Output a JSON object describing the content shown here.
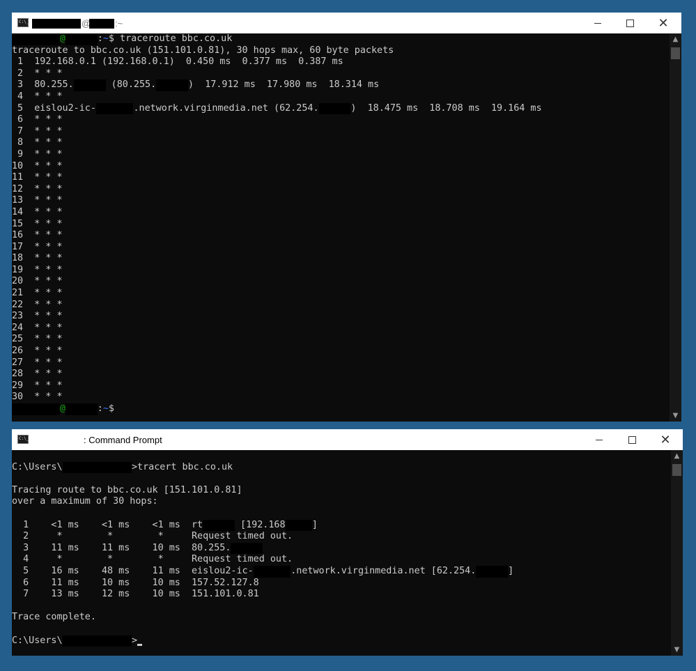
{
  "window1": {
    "title": ":~",
    "lines": [
      {
        "type": "prompt",
        "at": "@",
        "sep": ":",
        "tilde": "~",
        "dollar": "$ ",
        "cmd": "traceroute bbc.co.uk"
      },
      {
        "type": "text",
        "text": "traceroute to bbc.co.uk (151.101.0.81), 30 hops max, 60 byte packets"
      },
      {
        "type": "text",
        "text": " 1  192.168.0.1 (192.168.0.1)  0.450 ms  0.377 ms  0.387 ms"
      },
      {
        "type": "text",
        "text": " 2  * * *"
      },
      {
        "type": "parts",
        "parts": [
          " 3  80.255.",
          {
            "r": 6
          },
          " (80.255.",
          {
            "r": 6
          },
          ")  17.912 ms  17.980 ms  18.314 ms"
        ]
      },
      {
        "type": "text",
        "text": " 4  * * *"
      },
      {
        "type": "parts",
        "parts": [
          " 5  eislou2-ic-",
          {
            "r": 7
          },
          ".network.virginmedia.net (62.254.",
          {
            "r": 6
          },
          ")  18.475 ms  18.708 ms  19.164 ms"
        ]
      },
      {
        "type": "text",
        "text": " 6  * * *"
      },
      {
        "type": "text",
        "text": " 7  * * *"
      },
      {
        "type": "text",
        "text": " 8  * * *"
      },
      {
        "type": "text",
        "text": " 9  * * *"
      },
      {
        "type": "text",
        "text": "10  * * *"
      },
      {
        "type": "text",
        "text": "11  * * *"
      },
      {
        "type": "text",
        "text": "12  * * *"
      },
      {
        "type": "text",
        "text": "13  * * *"
      },
      {
        "type": "text",
        "text": "14  * * *"
      },
      {
        "type": "text",
        "text": "15  * * *"
      },
      {
        "type": "text",
        "text": "16  * * *"
      },
      {
        "type": "text",
        "text": "17  * * *"
      },
      {
        "type": "text",
        "text": "18  * * *"
      },
      {
        "type": "text",
        "text": "19  * * *"
      },
      {
        "type": "text",
        "text": "20  * * *"
      },
      {
        "type": "text",
        "text": "21  * * *"
      },
      {
        "type": "text",
        "text": "22  * * *"
      },
      {
        "type": "text",
        "text": "23  * * *"
      },
      {
        "type": "text",
        "text": "24  * * *"
      },
      {
        "type": "text",
        "text": "25  * * *"
      },
      {
        "type": "text",
        "text": "26  * * *"
      },
      {
        "type": "text",
        "text": "27  * * *"
      },
      {
        "type": "text",
        "text": "28  * * *"
      },
      {
        "type": "text",
        "text": "29  * * *"
      },
      {
        "type": "text",
        "text": "30  * * *"
      },
      {
        "type": "prompt",
        "at": "@",
        "sep": ":",
        "tilde": "~",
        "dollar": "$",
        "cmd": ""
      }
    ]
  },
  "window2": {
    "title": ": Command Prompt",
    "lines": [
      {
        "type": "text",
        "text": ""
      },
      {
        "type": "parts",
        "parts": [
          "C:\\Users\\",
          {
            "r": 13
          },
          ">tracert bbc.co.uk"
        ]
      },
      {
        "type": "text",
        "text": ""
      },
      {
        "type": "text",
        "text": "Tracing route to bbc.co.uk [151.101.0.81]"
      },
      {
        "type": "text",
        "text": "over a maximum of 30 hops:"
      },
      {
        "type": "text",
        "text": ""
      },
      {
        "type": "parts",
        "parts": [
          "  1    <1 ms    <1 ms    <1 ms  rt",
          {
            "r": 6
          },
          " [192.168",
          {
            "r": 5
          },
          "]"
        ]
      },
      {
        "type": "text",
        "text": "  2     *        *        *     Request timed out."
      },
      {
        "type": "parts",
        "parts": [
          "  3    11 ms    11 ms    10 ms  80.255.",
          {
            "r": 6
          }
        ]
      },
      {
        "type": "text",
        "text": "  4     *        *        *     Request timed out."
      },
      {
        "type": "parts",
        "parts": [
          "  5    16 ms    48 ms    11 ms  eislou2-ic-",
          {
            "r": 7
          },
          ".network.virginmedia.net [62.254.",
          {
            "r": 6
          },
          "]"
        ]
      },
      {
        "type": "text",
        "text": "  6    11 ms    10 ms    10 ms  157.52.127.8"
      },
      {
        "type": "text",
        "text": "  7    13 ms    12 ms    10 ms  151.101.0.81"
      },
      {
        "type": "text",
        "text": ""
      },
      {
        "type": "text",
        "text": "Trace complete."
      },
      {
        "type": "text",
        "text": ""
      },
      {
        "type": "parts",
        "parts": [
          "C:\\Users\\",
          {
            "r": 13
          },
          ">"
        ],
        "cursor": true
      }
    ]
  },
  "controls": {
    "minimize": "—",
    "maximize": "☐",
    "close": "✕"
  },
  "colors": {
    "desktop": "#245e8c",
    "terminal_bg": "#0c0c0c",
    "terminal_fg": "#cccccc",
    "prompt_green": "#13a10e",
    "prompt_blue": "#3b78ff"
  }
}
